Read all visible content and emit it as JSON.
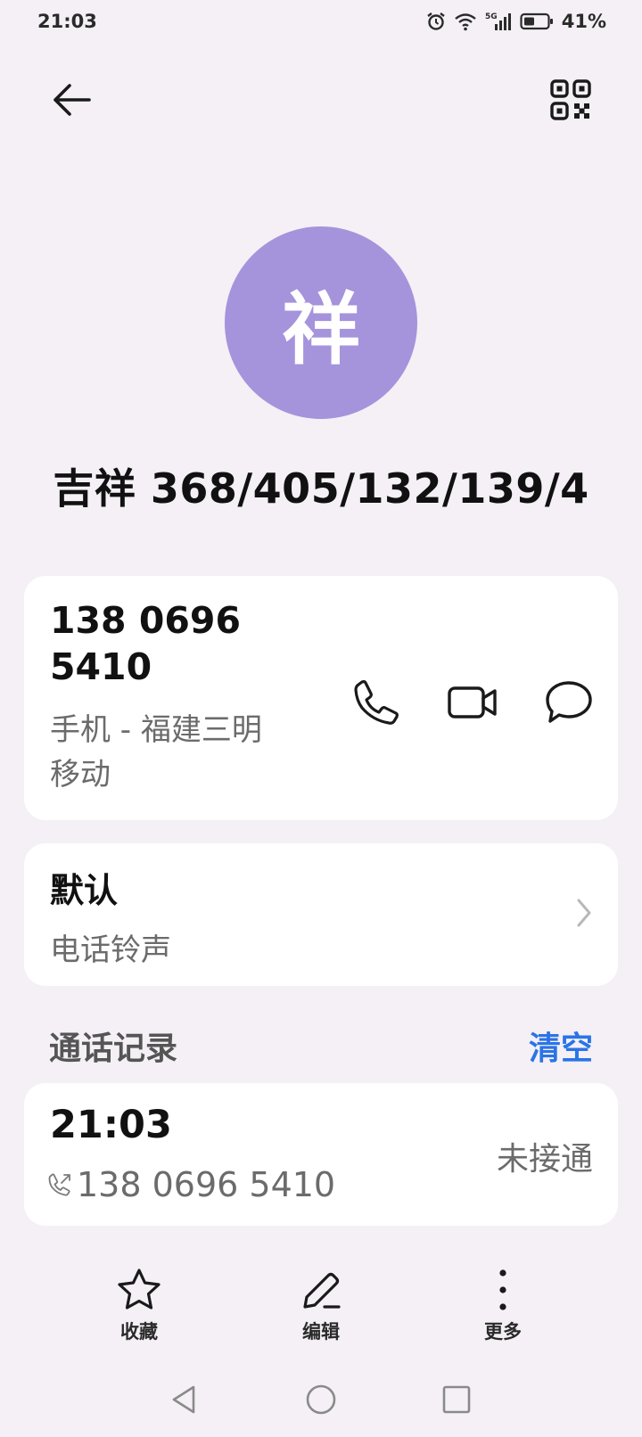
{
  "status_bar": {
    "time": "21:03",
    "network": "5G",
    "battery": "41%",
    "icons": [
      "alarm-icon",
      "wifi-icon",
      "signal-icon",
      "battery-icon"
    ]
  },
  "header": {
    "back_icon": "arrow-left-icon",
    "qr_icon": "qr-code-icon"
  },
  "contact": {
    "avatar_char": "祥",
    "avatar_color": "#a593dc",
    "name": "吉祥 368/405/132/139/4"
  },
  "phone_card": {
    "number_line1": "138 0696",
    "number_line2": "5410",
    "type_line1": "手机 - 福建三明",
    "type_line2": "移动",
    "actions": [
      "phone-icon",
      "video-call-icon",
      "message-icon"
    ]
  },
  "ringtone_card": {
    "title": "默认",
    "subtitle": "电话铃声"
  },
  "call_log": {
    "section_title": "通话记录",
    "clear_label": "清空",
    "accent_color": "#2a74e6",
    "entries": [
      {
        "time": "21:03",
        "number": "138 0696 5410",
        "status": "未接通"
      }
    ]
  },
  "bottom_actions": {
    "favorite": "收藏",
    "edit": "编辑",
    "more": "更多"
  }
}
